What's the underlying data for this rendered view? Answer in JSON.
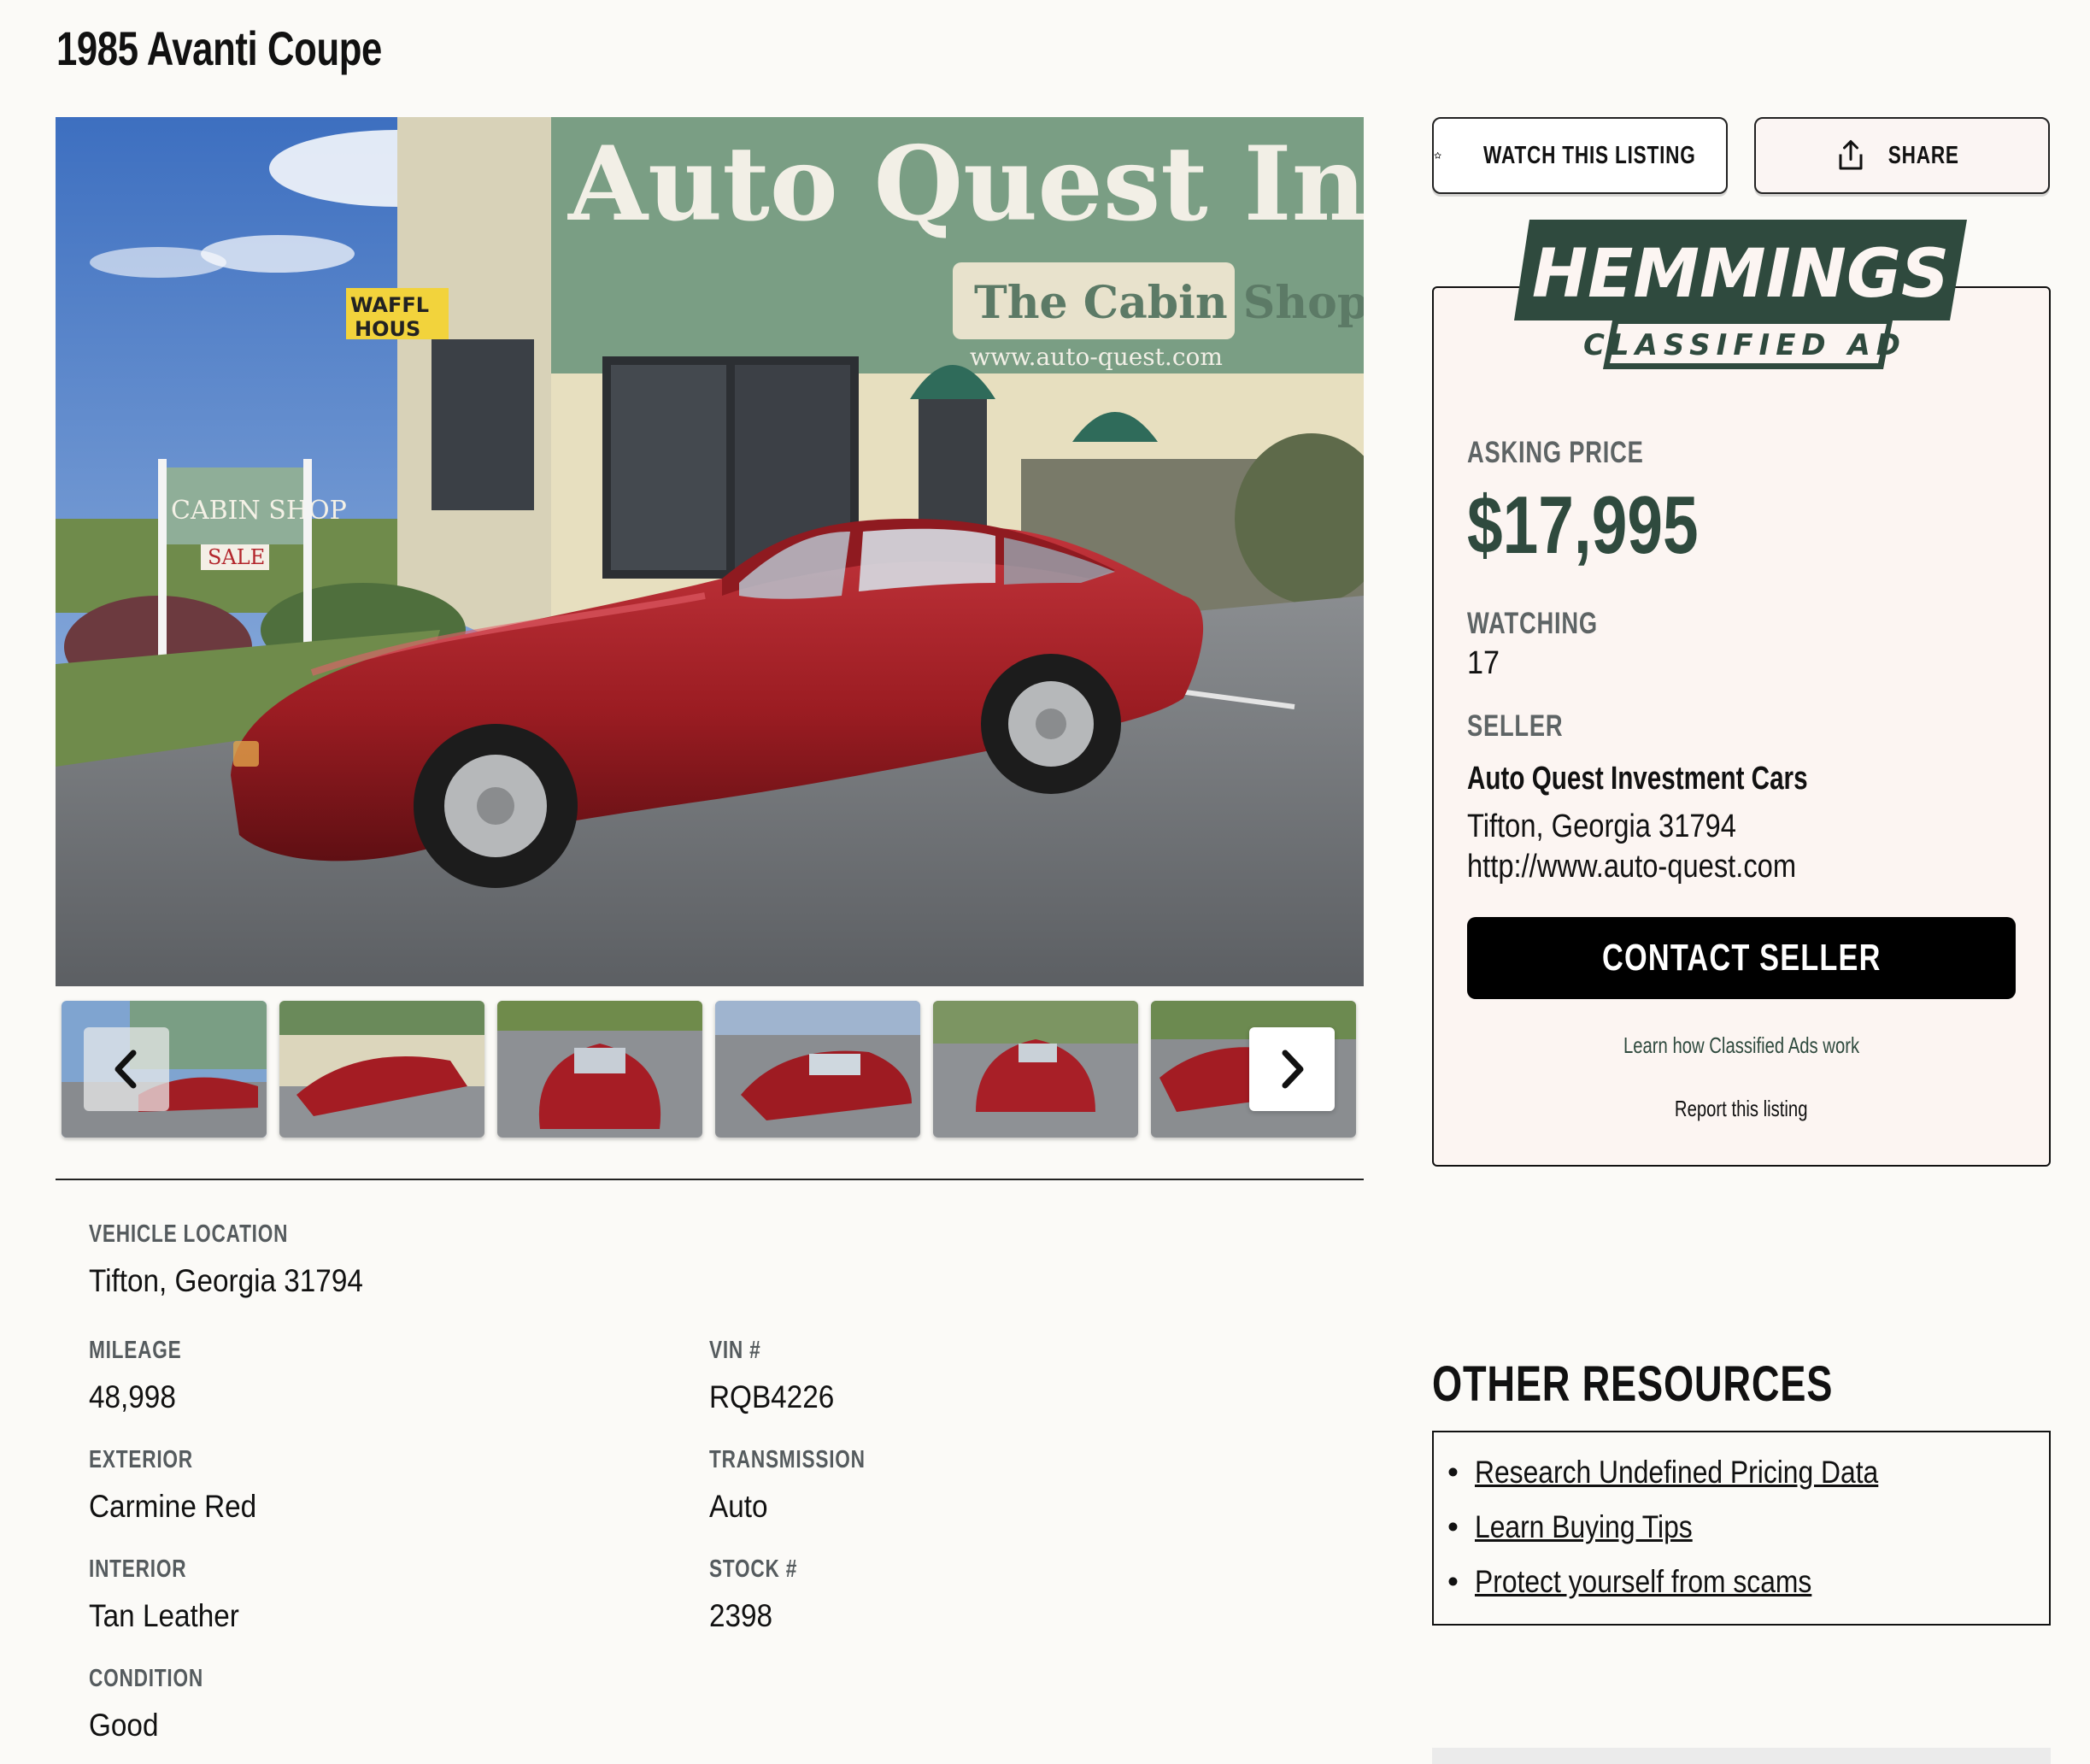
{
  "listing": {
    "title": "1985 Avanti Coupe"
  },
  "gallery": {
    "main_photo_alt": "Red 1985 Avanti Coupe parked in front of Auto Quest Investment Co building",
    "sign_text": "Auto Quest Investment Co",
    "sign_subtext": "The Cabin Shop",
    "sign_url": "www.auto-quest.com",
    "cabin_sign": "CABIN SHOP",
    "sale_sign": "SALE",
    "waffle_sign_1": "WAFFL",
    "waffle_sign_2": "HOUS"
  },
  "actions": {
    "watch_label": "WATCH THIS LISTING",
    "share_label": "SHARE"
  },
  "classified": {
    "brand": "HEMMINGS",
    "badge": "CLASSIFIED AD",
    "asking_price_label": "ASKING PRICE",
    "asking_price": "$17,995",
    "watching_label": "WATCHING",
    "watching_count": "17",
    "seller_label": "SELLER",
    "seller_name": "Auto Quest Investment Cars",
    "seller_location": "Tifton, Georgia 31794",
    "seller_url": "http://www.auto-quest.com",
    "contact_label": "CONTACT SELLER",
    "learn_link": "Learn how Classified Ads work",
    "report_link": "Report this listing"
  },
  "specs": {
    "location_label": "VEHICLE LOCATION",
    "location": "Tifton, Georgia 31794",
    "mileage_label": "MILEAGE",
    "mileage": "48,998",
    "vin_label": "VIN #",
    "vin": "RQB4226",
    "exterior_label": "EXTERIOR",
    "exterior": "Carmine Red",
    "transmission_label": "TRANSMISSION",
    "transmission": "Auto",
    "interior_label": "INTERIOR",
    "interior": "Tan Leather",
    "stock_label": "STOCK #",
    "stock": "2398",
    "condition_label": "CONDITION",
    "condition": "Good"
  },
  "resources": {
    "title": "OTHER RESOURCES",
    "items": [
      "Research Undefined Pricing Data",
      "Learn Buying Tips",
      "Protect yourself from scams"
    ]
  },
  "icons": {
    "watch": "star-outline-icon",
    "share": "share-upload-icon",
    "prev": "chevron-left-icon",
    "next": "chevron-right-icon"
  },
  "colors": {
    "brand_green": "#2f4a3e",
    "card_bg": "#fcf5f2",
    "page_bg": "#fbfaf7",
    "car_red": "#9b1c22"
  }
}
